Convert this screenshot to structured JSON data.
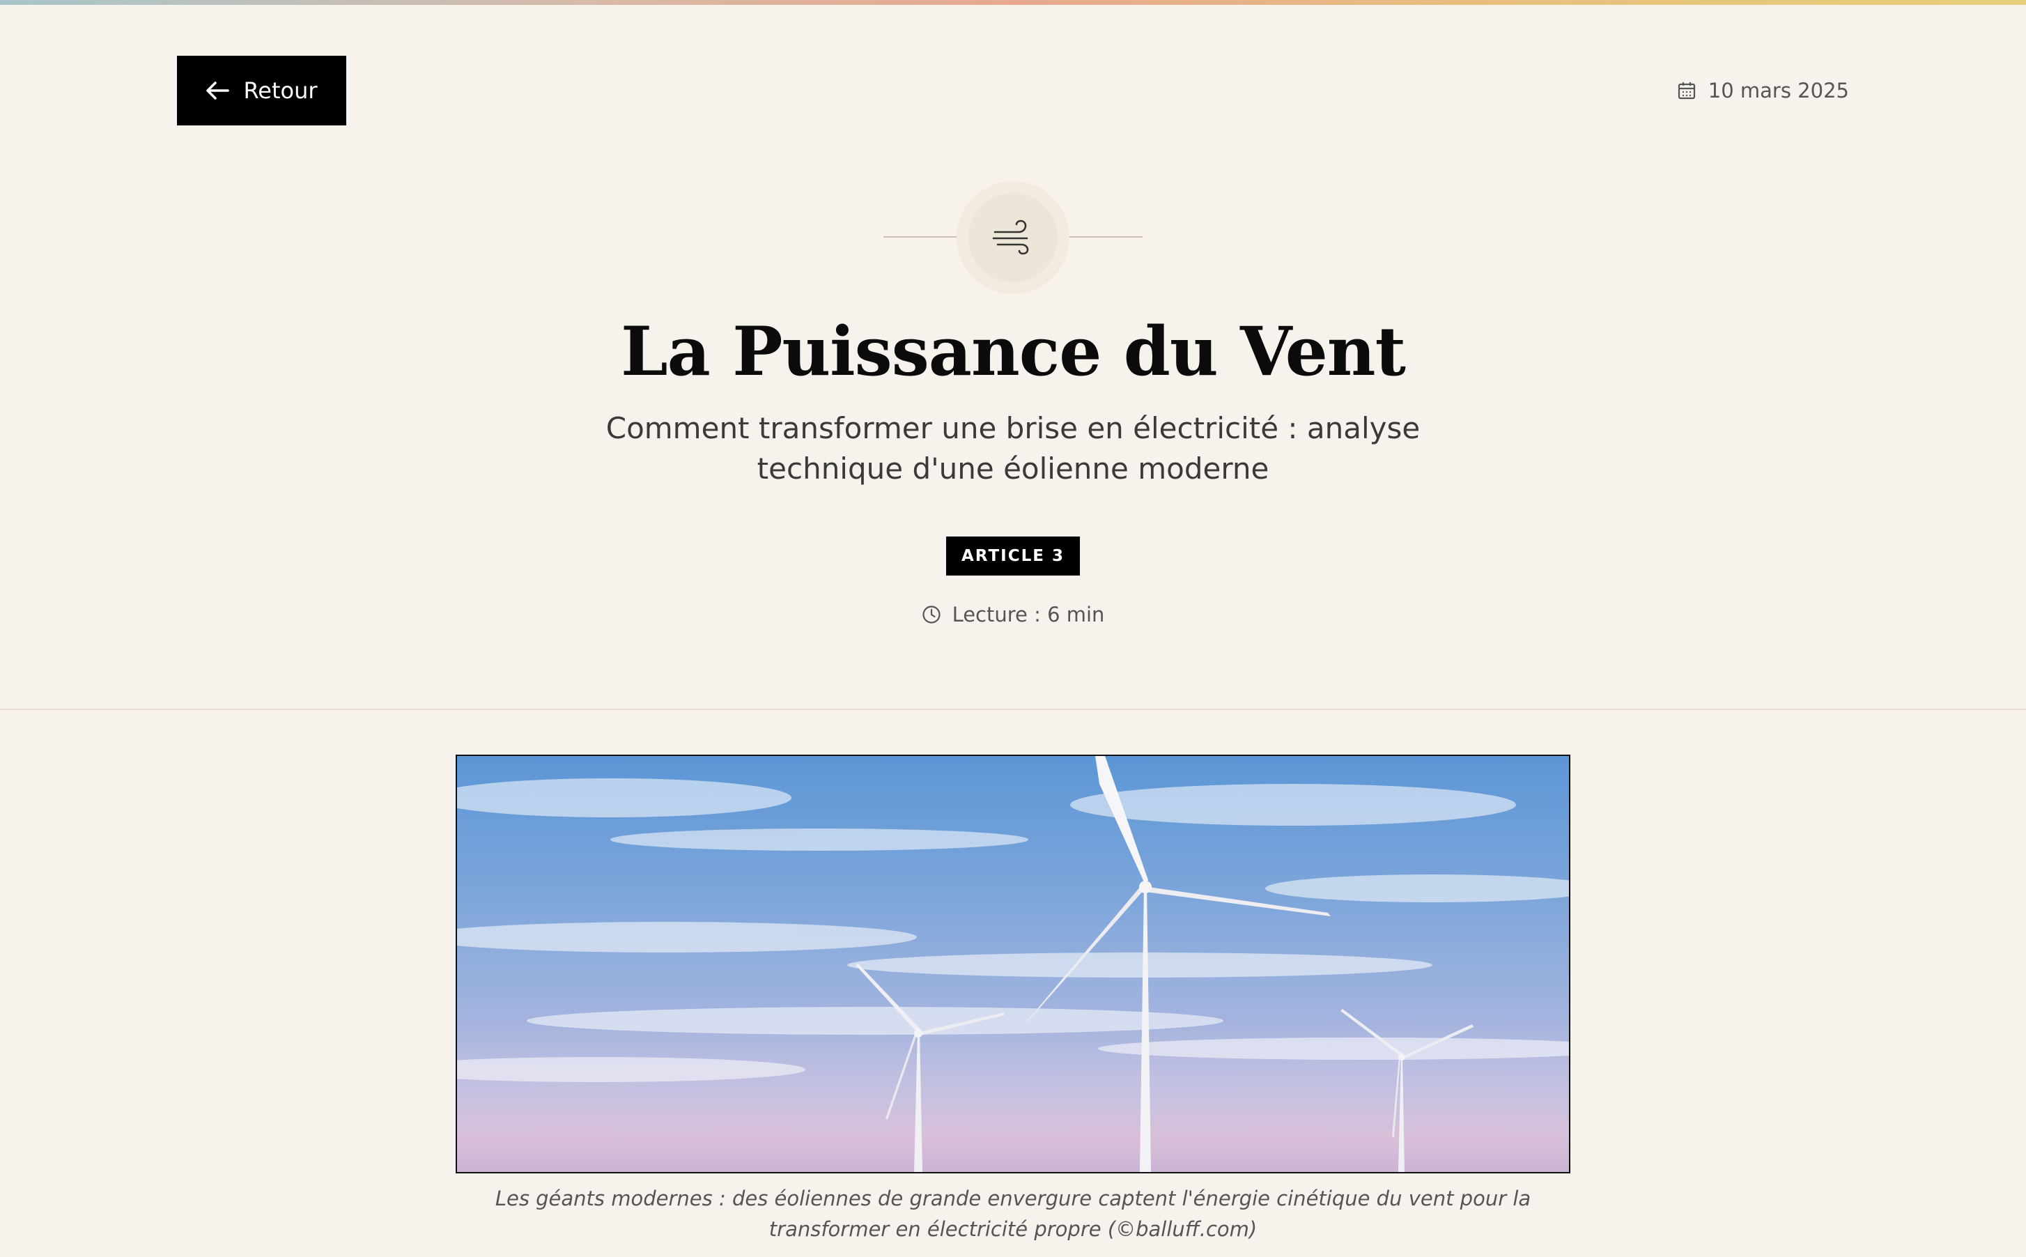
{
  "header": {
    "back_label": "Retour",
    "date": "10 mars 2025"
  },
  "article": {
    "emblem_icon": "wind-icon",
    "title": "La Puissance du Vent",
    "subtitle": "Comment transformer une brise en électricité : analyse technique d'une éolienne moderne",
    "badge": "ARTICLE 3",
    "reading_time": "Lecture : 6 min"
  },
  "hero": {
    "image_subject": "wind-turbines-under-blue-sky",
    "caption": "Les géants modernes : des éoliennes de grande envergure captent l'énergie cinétique du vent pour la transformer en électricité propre (©balluff.com)"
  },
  "colors": {
    "background": "#f7f3ec",
    "button": "#000000",
    "text": "#1a1a1a",
    "muted": "#555555"
  },
  "icons": {
    "back": "arrow-left-icon",
    "date": "calendar-icon",
    "reading": "clock-icon"
  }
}
